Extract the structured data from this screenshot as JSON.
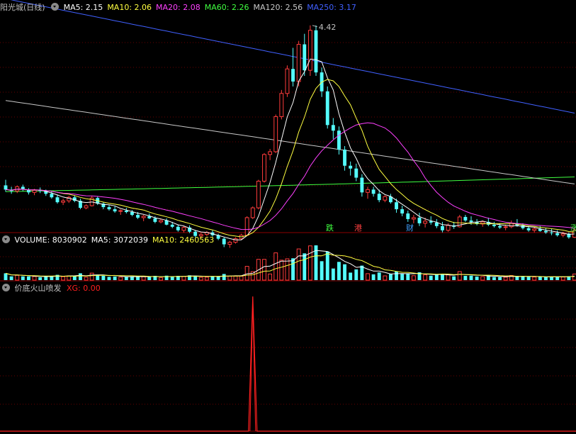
{
  "header": {
    "stock_name": "阳光城(日线)",
    "indicators": [
      {
        "label": "MA5: 2.15",
        "color": "#ffffff"
      },
      {
        "label": "MA10: 2.06",
        "color": "#ffff40"
      },
      {
        "label": "MA20: 2.08",
        "color": "#ff40ff"
      },
      {
        "label": "MA60: 2.26",
        "color": "#40ff40"
      },
      {
        "label": "MA120: 2.56",
        "color": "#c8c8c8"
      },
      {
        "label": "MA250: 3.17",
        "color": "#4060ff"
      }
    ]
  },
  "volume_header": {
    "items": [
      {
        "label": "VOLUME: 8030902",
        "color": "#ffffff"
      },
      {
        "label": "MA5: 3072039",
        "color": "#ffffff"
      },
      {
        "label": "MA10: 2460563",
        "color": "#ffff40"
      }
    ]
  },
  "indicator_header": {
    "name": "价底火山喷发",
    "xg_label": "XG: 0.00",
    "xg_color": "#ff2020"
  },
  "news_tags": [
    {
      "text": "跌",
      "color": "#40ff40"
    },
    {
      "text": "港",
      "color": "#ff4040"
    },
    {
      "text": "财",
      "color": "#40a0ff"
    },
    {
      "text": "涨",
      "color": "#40ff40"
    }
  ],
  "chart_data": {
    "type": "candlestick",
    "high_marker": "4.42",
    "y_range": [
      1.75,
      4.6
    ],
    "colors": {
      "up": "#ff3c3c",
      "down": "#54ffff"
    },
    "candles": [
      [
        2.14,
        2.22,
        2.05,
        2.08
      ],
      [
        2.08,
        2.12,
        2.02,
        2.06
      ],
      [
        2.06,
        2.14,
        2.03,
        2.12
      ],
      [
        2.12,
        2.15,
        2.06,
        2.08
      ],
      [
        2.08,
        2.1,
        2.01,
        2.04
      ],
      [
        2.04,
        2.09,
        2.0,
        2.07
      ],
      [
        2.07,
        2.11,
        2.03,
        2.06
      ],
      [
        2.06,
        2.08,
        1.99,
        2.02
      ],
      [
        2.02,
        2.05,
        1.95,
        1.97
      ],
      [
        1.97,
        2.0,
        1.88,
        1.9
      ],
      [
        1.9,
        1.95,
        1.86,
        1.92
      ],
      [
        1.92,
        1.99,
        1.89,
        1.97
      ],
      [
        1.97,
        2.0,
        1.9,
        1.92
      ],
      [
        1.92,
        1.95,
        1.8,
        1.82
      ],
      [
        1.82,
        1.87,
        1.8,
        1.85
      ],
      [
        1.85,
        1.99,
        1.84,
        1.96
      ],
      [
        1.96,
        1.98,
        1.86,
        1.88
      ],
      [
        1.88,
        1.9,
        1.8,
        1.83
      ],
      [
        1.83,
        1.86,
        1.78,
        1.8
      ],
      [
        1.8,
        1.84,
        1.75,
        1.77
      ],
      [
        1.77,
        1.8,
        1.72,
        1.78
      ],
      [
        1.78,
        1.82,
        1.74,
        1.76
      ],
      [
        1.76,
        1.79,
        1.7,
        1.72
      ],
      [
        1.72,
        1.76,
        1.66,
        1.68
      ],
      [
        1.68,
        1.72,
        1.63,
        1.7
      ],
      [
        1.7,
        1.74,
        1.66,
        1.67
      ],
      [
        1.67,
        1.7,
        1.6,
        1.62
      ],
      [
        1.62,
        1.66,
        1.6,
        1.64
      ],
      [
        1.64,
        1.67,
        1.57,
        1.58
      ],
      [
        1.58,
        1.62,
        1.53,
        1.55
      ],
      [
        1.55,
        1.58,
        1.48,
        1.5
      ],
      [
        1.5,
        1.56,
        1.47,
        1.54
      ],
      [
        1.54,
        1.57,
        1.46,
        1.48
      ],
      [
        1.48,
        1.5,
        1.4,
        1.42
      ],
      [
        1.42,
        1.46,
        1.39,
        1.44
      ],
      [
        1.44,
        1.49,
        1.42,
        1.47
      ],
      [
        1.47,
        1.5,
        1.41,
        1.43
      ],
      [
        1.43,
        1.45,
        1.36,
        1.38
      ],
      [
        1.38,
        1.4,
        1.26,
        1.3
      ],
      [
        1.3,
        1.35,
        1.25,
        1.33
      ],
      [
        1.33,
        1.4,
        1.31,
        1.38
      ],
      [
        1.38,
        1.45,
        1.36,
        1.43
      ],
      [
        1.43,
        1.7,
        1.42,
        1.68
      ],
      [
        1.68,
        1.84,
        1.66,
        1.82
      ],
      [
        1.82,
        2.22,
        1.8,
        2.2
      ],
      [
        2.2,
        2.6,
        2.18,
        2.58
      ],
      [
        2.58,
        2.66,
        2.5,
        2.62
      ],
      [
        2.62,
        3.15,
        2.6,
        3.12
      ],
      [
        3.12,
        3.5,
        3.08,
        3.45
      ],
      [
        3.45,
        3.85,
        3.4,
        3.8
      ],
      [
        3.8,
        4.1,
        3.55,
        3.62
      ],
      [
        3.62,
        4.2,
        3.55,
        4.15
      ],
      [
        4.15,
        4.3,
        3.7,
        3.78
      ],
      [
        3.78,
        4.42,
        3.7,
        4.35
      ],
      [
        4.35,
        4.42,
        3.7,
        3.75
      ],
      [
        3.75,
        3.82,
        3.4,
        3.48
      ],
      [
        3.48,
        3.55,
        2.95,
        3.0
      ],
      [
        3.0,
        3.1,
        2.8,
        2.92
      ],
      [
        2.92,
        2.98,
        2.58,
        2.65
      ],
      [
        2.65,
        2.7,
        2.35,
        2.42
      ],
      [
        2.42,
        2.48,
        2.28,
        2.38
      ],
      [
        2.38,
        2.45,
        2.2,
        2.25
      ],
      [
        2.25,
        2.3,
        1.98,
        2.04
      ],
      [
        2.04,
        2.12,
        1.95,
        2.08
      ],
      [
        2.08,
        2.12,
        1.98,
        2.02
      ],
      [
        2.02,
        2.08,
        1.9,
        1.93
      ],
      [
        1.93,
        2.0,
        1.9,
        1.98
      ],
      [
        1.98,
        2.02,
        1.88,
        1.9
      ],
      [
        1.9,
        1.95,
        1.75,
        1.8
      ],
      [
        1.8,
        1.85,
        1.7,
        1.74
      ],
      [
        1.74,
        1.78,
        1.62,
        1.66
      ],
      [
        1.66,
        1.72,
        1.6,
        1.68
      ],
      [
        1.68,
        1.75,
        1.56,
        1.6
      ],
      [
        1.6,
        1.68,
        1.54,
        1.63
      ],
      [
        1.63,
        1.7,
        1.58,
        1.61
      ],
      [
        1.61,
        1.66,
        1.53,
        1.56
      ],
      [
        1.56,
        1.62,
        1.47,
        1.5
      ],
      [
        1.5,
        1.6,
        1.48,
        1.57
      ],
      [
        1.57,
        1.62,
        1.52,
        1.55
      ],
      [
        1.55,
        1.72,
        1.54,
        1.69
      ],
      [
        1.69,
        1.72,
        1.62,
        1.64
      ],
      [
        1.64,
        1.7,
        1.58,
        1.62
      ],
      [
        1.62,
        1.66,
        1.57,
        1.59
      ],
      [
        1.59,
        1.64,
        1.55,
        1.62
      ],
      [
        1.62,
        1.68,
        1.56,
        1.58
      ],
      [
        1.58,
        1.62,
        1.54,
        1.56
      ],
      [
        1.56,
        1.6,
        1.52,
        1.54
      ],
      [
        1.54,
        1.58,
        1.5,
        1.55
      ],
      [
        1.55,
        1.64,
        1.53,
        1.6
      ],
      [
        1.6,
        1.66,
        1.55,
        1.57
      ],
      [
        1.57,
        1.6,
        1.51,
        1.53
      ],
      [
        1.53,
        1.56,
        1.48,
        1.5
      ],
      [
        1.5,
        1.55,
        1.47,
        1.52
      ],
      [
        1.52,
        1.56,
        1.48,
        1.49
      ],
      [
        1.49,
        1.53,
        1.45,
        1.47
      ],
      [
        1.47,
        1.52,
        1.43,
        1.46
      ],
      [
        1.46,
        1.5,
        1.41,
        1.43
      ],
      [
        1.43,
        1.48,
        1.4,
        1.45
      ],
      [
        1.45,
        1.47,
        1.38,
        1.4
      ],
      [
        1.4,
        1.52,
        1.39,
        1.5
      ]
    ],
    "ma_series": [
      {
        "name": "MA5",
        "color": "#ffffff",
        "window": 5
      },
      {
        "name": "MA10",
        "color": "#ffff40",
        "window": 10
      },
      {
        "name": "MA20",
        "color": "#ff40ff",
        "window": 20
      },
      {
        "name": "MA60",
        "color": "#40ff40",
        "values_start": 2.05,
        "values_end": 2.26,
        "peak": 2.14
      },
      {
        "name": "MA120",
        "color": "#c8c8c8",
        "values_start": 3.35,
        "values_end": 2.16
      },
      {
        "name": "MA250",
        "color": "#4060ff",
        "values_start": 4.8,
        "values_end": 3.17
      }
    ],
    "volume_colors": {
      "up": "#ff3c3c",
      "down": "#54ffff"
    },
    "volume_ma": [
      {
        "name": "MA5",
        "color": "#ffffff",
        "window": 5
      },
      {
        "name": "MA10",
        "color": "#ffff40",
        "window": 10
      }
    ],
    "xg_signal_index": 43,
    "xg_line_color": "#ff2020"
  }
}
